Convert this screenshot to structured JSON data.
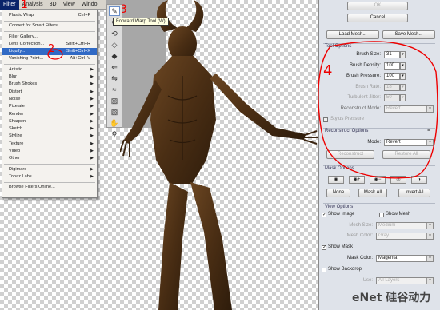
{
  "menubar": {
    "items": [
      "Filter",
      "Analysis",
      "3D",
      "View",
      "Windo"
    ]
  },
  "filter_menu": {
    "groups": [
      [
        {
          "label": "Plastic Wrap",
          "shortcut": "Ctrl+F"
        }
      ],
      [
        {
          "label": "Convert for Smart Filters",
          "shortcut": ""
        }
      ],
      [
        {
          "label": "Filter Gallery...",
          "shortcut": ""
        },
        {
          "label": "Lens Correction...",
          "shortcut": "Shift+Ctrl+R"
        },
        {
          "label": "Liquify...",
          "shortcut": "Shift+Ctrl+X"
        },
        {
          "label": "Vanishing Point...",
          "shortcut": "Alt+Ctrl+V"
        }
      ],
      [
        {
          "label": "Artistic"
        },
        {
          "label": "Blur"
        },
        {
          "label": "Brush Strokes"
        },
        {
          "label": "Distort"
        },
        {
          "label": "Noise"
        },
        {
          "label": "Pixelate"
        },
        {
          "label": "Render"
        },
        {
          "label": "Sharpen"
        },
        {
          "label": "Sketch"
        },
        {
          "label": "Stylize"
        },
        {
          "label": "Texture"
        },
        {
          "label": "Video"
        },
        {
          "label": "Other"
        }
      ],
      [
        {
          "label": "Digimarc"
        },
        {
          "label": "Topaz Labs"
        }
      ],
      [
        {
          "label": "Browse Filters Online..."
        }
      ]
    ],
    "highlighted": "Liquify..."
  },
  "annotations": {
    "one": "1",
    "two": "2",
    "three": "3",
    "four": "4"
  },
  "tooltip": "Forward Warp Tool (W)",
  "panel": {
    "ok": "OK",
    "cancel": "Cancel",
    "load_mesh": "Load Mesh...",
    "save_mesh": "Save Mesh...",
    "tool_options": {
      "title": "Tool Options",
      "brush_size_label": "Brush Size:",
      "brush_size": "31",
      "brush_density_label": "Brush Density:",
      "brush_density": "100",
      "brush_pressure_label": "Brush Pressure:",
      "brush_pressure": "100",
      "brush_rate_label": "Brush Rate:",
      "brush_rate": "18",
      "turbulent_jitter_label": "Turbulent Jitter:",
      "turbulent_jitter": "50",
      "reconstruct_mode_label": "Reconstruct Mode:",
      "reconstruct_mode": "Revert",
      "stylus_pressure": "Stylus Pressure"
    },
    "reconstruct_options": {
      "title": "Reconstruct Options",
      "mode_label": "Mode:",
      "mode": "Revert",
      "reconstruct": "Reconstruct",
      "restore_all": "Restore All"
    },
    "mask_options": {
      "title": "Mask Options",
      "none": "None",
      "mask_all": "Mask All",
      "invert_all": "Invert All"
    },
    "view_options": {
      "title": "View Options",
      "show_image": "Show Image",
      "show_mesh": "Show Mesh",
      "mesh_size_label": "Mesh Size:",
      "mesh_size": "Medium",
      "mesh_color_label": "Mesh Color:",
      "mesh_color": "Gray",
      "show_mask": "Show Mask",
      "mask_color_label": "Mask Color:",
      "mask_color": "Magenta",
      "show_backdrop": "Show Backdrop",
      "use_label": "Use:",
      "use": "All Layers"
    }
  },
  "watermark": "eNet 硅谷动力",
  "colors": {
    "annotation": "#e00000",
    "highlight": "#316ac5",
    "figure": "#4a2e14"
  }
}
